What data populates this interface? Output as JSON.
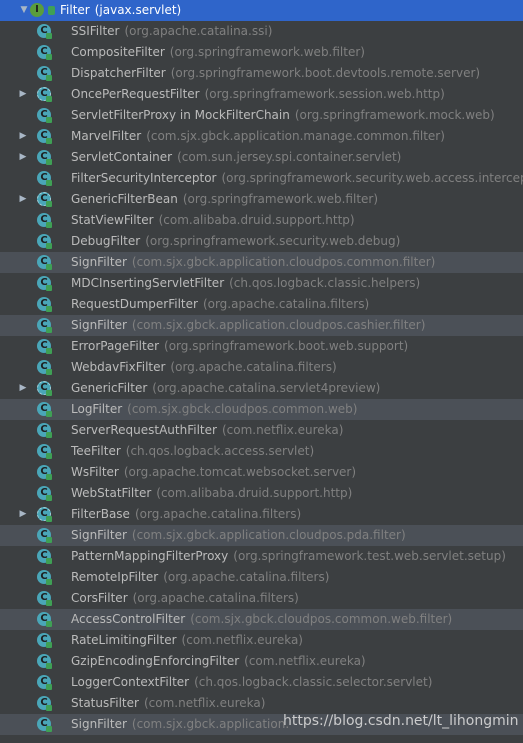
{
  "root": {
    "name": "Filter",
    "pkg": "(javax.servlet)"
  },
  "items": [
    {
      "name": "SSIFilter",
      "pkg": "(org.apache.catalina.ssi)",
      "expandable": false,
      "icon": "class-icon"
    },
    {
      "name": "CompositeFilter",
      "pkg": "(org.springframework.web.filter)",
      "expandable": false,
      "icon": "class-icon"
    },
    {
      "name": "DispatcherFilter",
      "pkg": "(org.springframework.boot.devtools.remote.server)",
      "expandable": false,
      "icon": "class-icon"
    },
    {
      "name": "OncePerRequestFilter",
      "pkg": "(org.springframework.session.web.http)",
      "expandable": true,
      "icon": "abstract-class-icon"
    },
    {
      "name": "ServletFilterProxy in MockFilterChain",
      "pkg": "(org.springframework.mock.web)",
      "expandable": false,
      "icon": "class-icon"
    },
    {
      "name": "MarvelFilter",
      "pkg": "(com.sjx.gbck.application.manage.common.filter)",
      "expandable": true,
      "icon": "class-icon"
    },
    {
      "name": "ServletContainer",
      "pkg": "(com.sun.jersey.spi.container.servlet)",
      "expandable": true,
      "icon": "class-icon"
    },
    {
      "name": "FilterSecurityInterceptor",
      "pkg": "(org.springframework.security.web.access.intercept)",
      "expandable": false,
      "icon": "class-icon"
    },
    {
      "name": "GenericFilterBean",
      "pkg": "(org.springframework.web.filter)",
      "expandable": true,
      "icon": "abstract-class-icon"
    },
    {
      "name": "StatViewFilter",
      "pkg": "(com.alibaba.druid.support.http)",
      "expandable": false,
      "icon": "class-icon"
    },
    {
      "name": "DebugFilter",
      "pkg": "(org.springframework.security.web.debug)",
      "expandable": false,
      "icon": "class-icon"
    },
    {
      "name": "SignFilter",
      "pkg": "(com.sjx.gbck.application.cloudpos.common.filter)",
      "expandable": false,
      "icon": "class-icon",
      "highlight": true
    },
    {
      "name": "MDCInsertingServletFilter",
      "pkg": "(ch.qos.logback.classic.helpers)",
      "expandable": false,
      "icon": "class-icon"
    },
    {
      "name": "RequestDumperFilter",
      "pkg": "(org.apache.catalina.filters)",
      "expandable": false,
      "icon": "class-icon"
    },
    {
      "name": "SignFilter",
      "pkg": "(com.sjx.gbck.application.cloudpos.cashier.filter)",
      "expandable": false,
      "icon": "class-icon",
      "highlight": true
    },
    {
      "name": "ErrorPageFilter",
      "pkg": "(org.springframework.boot.web.support)",
      "expandable": false,
      "icon": "class-icon"
    },
    {
      "name": "WebdavFixFilter",
      "pkg": "(org.apache.catalina.filters)",
      "expandable": false,
      "icon": "class-icon"
    },
    {
      "name": "GenericFilter",
      "pkg": "(org.apache.catalina.servlet4preview)",
      "expandable": true,
      "icon": "abstract-class-icon"
    },
    {
      "name": "LogFilter",
      "pkg": "(com.sjx.gbck.cloudpos.common.web)",
      "expandable": false,
      "icon": "class-icon",
      "highlight": true
    },
    {
      "name": "ServerRequestAuthFilter",
      "pkg": "(com.netflix.eureka)",
      "expandable": false,
      "icon": "class-icon"
    },
    {
      "name": "TeeFilter",
      "pkg": "(ch.qos.logback.access.servlet)",
      "expandable": false,
      "icon": "class-icon"
    },
    {
      "name": "WsFilter",
      "pkg": "(org.apache.tomcat.websocket.server)",
      "expandable": false,
      "icon": "class-icon"
    },
    {
      "name": "WebStatFilter",
      "pkg": "(com.alibaba.druid.support.http)",
      "expandable": false,
      "icon": "class-icon"
    },
    {
      "name": "FilterBase",
      "pkg": "(org.apache.catalina.filters)",
      "expandable": true,
      "icon": "abstract-class-icon"
    },
    {
      "name": "SignFilter",
      "pkg": "(com.sjx.gbck.application.cloudpos.pda.filter)",
      "expandable": false,
      "icon": "class-icon",
      "highlight": true
    },
    {
      "name": "PatternMappingFilterProxy",
      "pkg": "(org.springframework.test.web.servlet.setup)",
      "expandable": false,
      "icon": "class-icon"
    },
    {
      "name": "RemoteIpFilter",
      "pkg": "(org.apache.catalina.filters)",
      "expandable": false,
      "icon": "class-icon"
    },
    {
      "name": "CorsFilter",
      "pkg": "(org.apache.catalina.filters)",
      "expandable": false,
      "icon": "class-icon"
    },
    {
      "name": "AccessControlFilter",
      "pkg": "(com.sjx.gbck.cloudpos.common.web.filter)",
      "expandable": false,
      "icon": "class-icon",
      "highlight": true
    },
    {
      "name": "RateLimitingFilter",
      "pkg": "(com.netflix.eureka)",
      "expandable": false,
      "icon": "class-icon"
    },
    {
      "name": "GzipEncodingEnforcingFilter",
      "pkg": "(com.netflix.eureka)",
      "expandable": false,
      "icon": "class-icon"
    },
    {
      "name": "LoggerContextFilter",
      "pkg": "(ch.qos.logback.classic.selector.servlet)",
      "expandable": false,
      "icon": "class-icon"
    },
    {
      "name": "StatusFilter",
      "pkg": "(com.netflix.eureka)",
      "expandable": false,
      "icon": "class-icon"
    },
    {
      "name": "SignFilter",
      "pkg": "(com.sjx.gbck.application.",
      "expandable": false,
      "icon": "class-icon",
      "highlight": true
    }
  ],
  "watermark": "https://blog.csdn.net/lt_lihongmin"
}
